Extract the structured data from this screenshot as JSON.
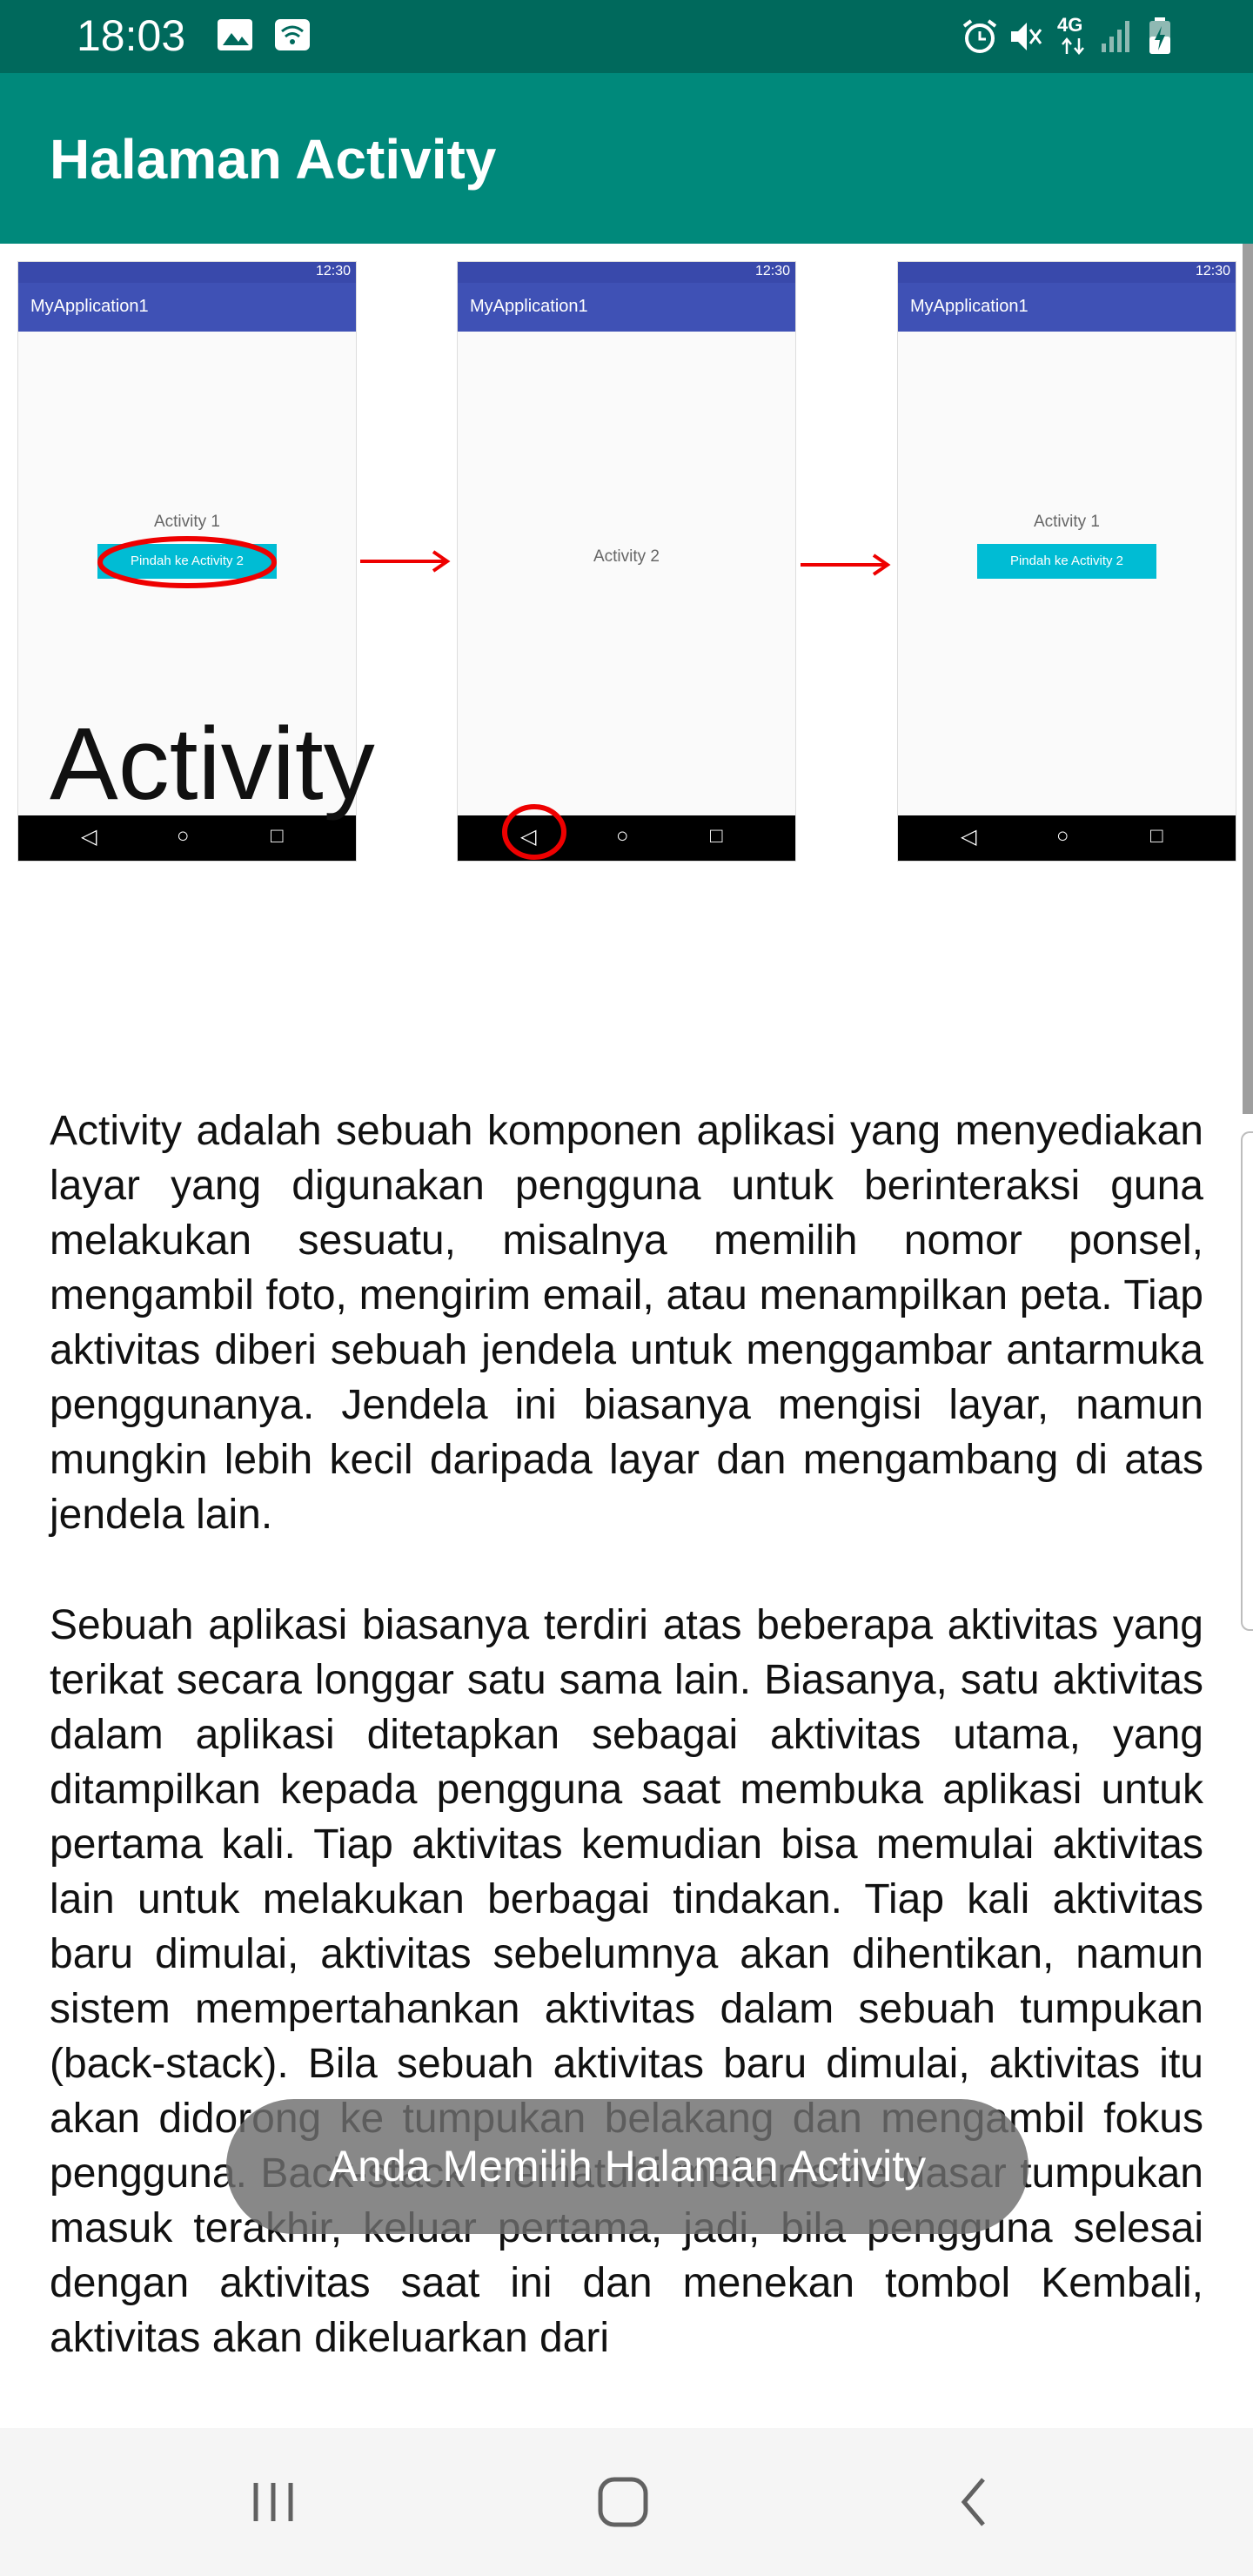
{
  "status_bar": {
    "time": "18:03",
    "left_icons": [
      "image-icon",
      "wifi-calling-icon"
    ],
    "right_icons": [
      "alarm-icon",
      "mute-icon",
      "4g-icon",
      "signal-icon",
      "battery-charging-icon"
    ],
    "network_label": "4G"
  },
  "app_bar": {
    "title": "Halaman Activity",
    "color": "#00897b"
  },
  "figure": {
    "phones": [
      {
        "time": "12:30",
        "app_title": "MyApplication1",
        "activity_label": "Activity 1",
        "button_label": "Pindah ke Activity 2"
      },
      {
        "time": "12:30",
        "app_title": "MyApplication1",
        "activity_label": "Activity 2"
      },
      {
        "time": "12:30",
        "app_title": "MyApplication1",
        "activity_label": "Activity 1",
        "button_label": "Pindah ke Activity 2"
      }
    ]
  },
  "article": {
    "heading": "Activity",
    "paragraph1": "Activity adalah sebuah komponen aplikasi yang menyediakan layar yang digunakan pengguna untuk berinteraksi guna melakukan sesuatu, misalnya memilih nomor ponsel, mengambil foto, mengirim email, atau menampilkan peta. Tiap aktivitas diberi sebuah jendela untuk menggambar antarmuka penggunanya. Jendela ini biasanya mengisi layar, namun mungkin lebih kecil daripada layar dan mengambang di atas jendela lain.",
    "paragraph2": "Sebuah aplikasi biasanya terdiri atas beberapa aktivitas yang terikat secara longgar satu sama lain. Biasanya, satu aktivitas dalam aplikasi ditetapkan sebagai aktivitas utama, yang ditampilkan kepada pengguna saat membuka aplikasi untuk pertama kali. Tiap aktivitas kemudian bisa memulai aktivitas lain untuk melakukan berbagai tindakan. Tiap kali aktivitas baru dimulai, aktivitas sebelumnya akan dihentikan, namun sistem mempertahankan aktivitas dalam sebuah tumpukan (back-stack). Bila sebuah aktivitas baru dimulai, aktivitas itu akan didorong ke tumpukan belakang dan mengambil fokus pengguna. Back-stack mematuhi mekanisme dasar tumpukan masuk terakhir, keluar pertama, jadi, bila pengguna selesai dengan aktivitas saat ini dan menekan tombol Kembali, aktivitas akan dikeluarkan dari"
  },
  "toast": {
    "message": "Anda Memilih Halaman Activity"
  },
  "nav_bar": {
    "buttons": [
      "recents-icon",
      "home-icon",
      "back-icon"
    ]
  }
}
